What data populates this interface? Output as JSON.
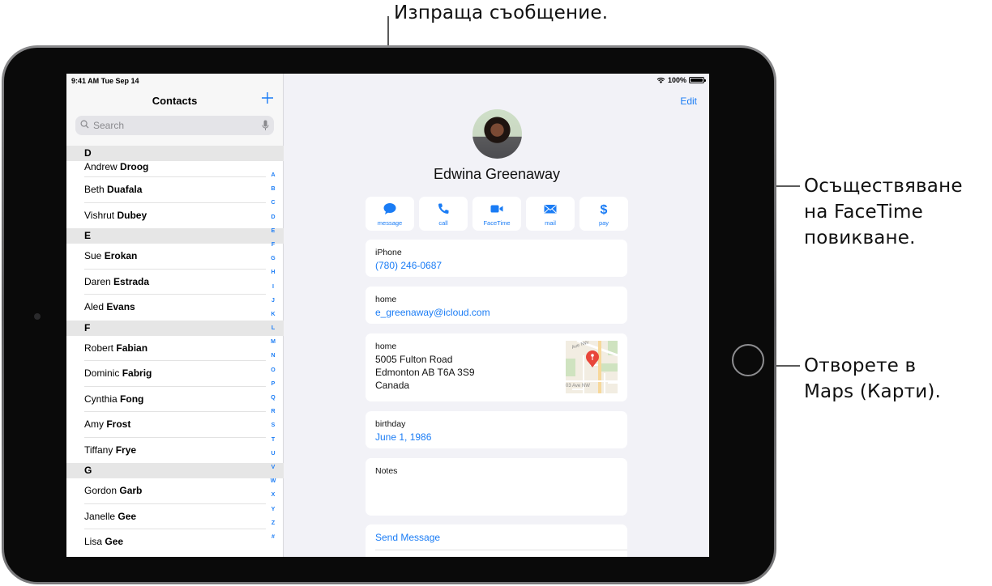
{
  "callouts": {
    "message": "Изпраща съобщение.",
    "facetime": [
      "Осъществяване",
      "на FaceTime",
      "повикване."
    ],
    "maps": [
      "Отворете в",
      "Maps (Карти)."
    ]
  },
  "status_bar": {
    "time": "9:41 AM  Tue Sep 14",
    "battery": "100%",
    "battery_level": 1.0
  },
  "sidebar": {
    "title": "Contacts",
    "add_icon": "plus-icon",
    "search_placeholder": "Search",
    "sections": [
      {
        "letter": "D",
        "contacts": [
          {
            "first": "Andrew",
            "last": "Droog"
          },
          {
            "first": "Beth",
            "last": "Duafala"
          },
          {
            "first": "Vishrut",
            "last": "Dubey"
          }
        ]
      },
      {
        "letter": "E",
        "contacts": [
          {
            "first": "Sue",
            "last": "Erokan"
          },
          {
            "first": "Daren",
            "last": "Estrada"
          },
          {
            "first": "Aled",
            "last": "Evans"
          }
        ]
      },
      {
        "letter": "F",
        "contacts": [
          {
            "first": "Robert",
            "last": "Fabian"
          },
          {
            "first": "Dominic",
            "last": "Fabrig"
          },
          {
            "first": "Cynthia",
            "last": "Fong"
          },
          {
            "first": "Amy",
            "last": "Frost"
          },
          {
            "first": "Tiffany",
            "last": "Frye"
          }
        ]
      },
      {
        "letter": "G",
        "contacts": [
          {
            "first": "Gordon",
            "last": "Garb"
          },
          {
            "first": "Janelle",
            "last": "Gee"
          },
          {
            "first": "Lisa",
            "last": "Gee"
          }
        ]
      }
    ],
    "index_letters": [
      "A",
      "B",
      "C",
      "D",
      "E",
      "F",
      "G",
      "H",
      "I",
      "J",
      "K",
      "L",
      "M",
      "N",
      "O",
      "P",
      "Q",
      "R",
      "S",
      "T",
      "U",
      "V",
      "W",
      "X",
      "Y",
      "Z",
      "#"
    ]
  },
  "detail": {
    "edit_label": "Edit",
    "name": "Edwina Greenaway",
    "actions": [
      {
        "label": "message",
        "icon": "message-bubble-icon"
      },
      {
        "label": "call",
        "icon": "phone-icon"
      },
      {
        "label": "FaceTime",
        "icon": "video-camera-icon"
      },
      {
        "label": "mail",
        "icon": "envelope-icon"
      },
      {
        "label": "pay",
        "icon": "dollar-icon"
      }
    ],
    "phone": {
      "label": "iPhone",
      "value": "(780) 246-0687"
    },
    "email": {
      "label": "home",
      "value": "e_greenaway@icloud.com"
    },
    "address": {
      "label": "home",
      "lines": [
        "5005 Fulton Road",
        "Edmonton AB T6A 3S9",
        "Canada"
      ],
      "map_streets": [
        "Ave NW",
        "03 Ave NW"
      ]
    },
    "birthday": {
      "label": "birthday",
      "value": "June 1, 1986"
    },
    "notes": {
      "label": "Notes",
      "value": ""
    },
    "send_message": "Send Message"
  },
  "colors": {
    "accent": "#1a7cf5",
    "background": "#f2f2f7",
    "pin": "#e8463a"
  }
}
